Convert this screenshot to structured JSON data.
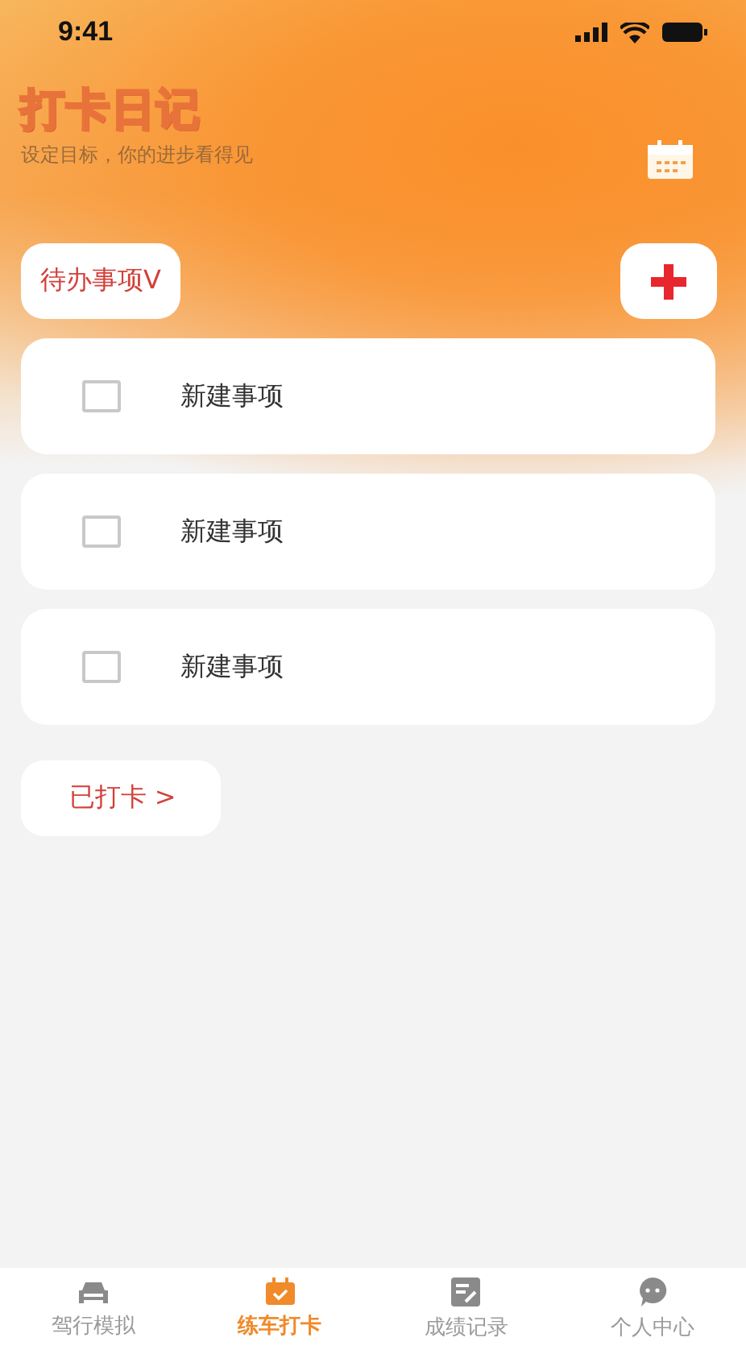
{
  "status_bar": {
    "time": "9:41"
  },
  "header": {
    "title": "打卡日记",
    "subtitle": "设定目标，你的进步看得见"
  },
  "pending_toggle": {
    "label": "待办事项V"
  },
  "tasks": [
    {
      "label": "新建事项",
      "checked": false
    },
    {
      "label": "新建事项",
      "checked": false
    },
    {
      "label": "新建事项",
      "checked": false
    }
  ],
  "done_toggle": {
    "label": "已打卡 >"
  },
  "tab_bar": [
    {
      "label": "驾行模拟",
      "selected": false
    },
    {
      "label": "练车打卡",
      "selected": true
    },
    {
      "label": "成绩记录",
      "selected": false
    },
    {
      "label": "个人中心",
      "selected": false
    }
  ]
}
